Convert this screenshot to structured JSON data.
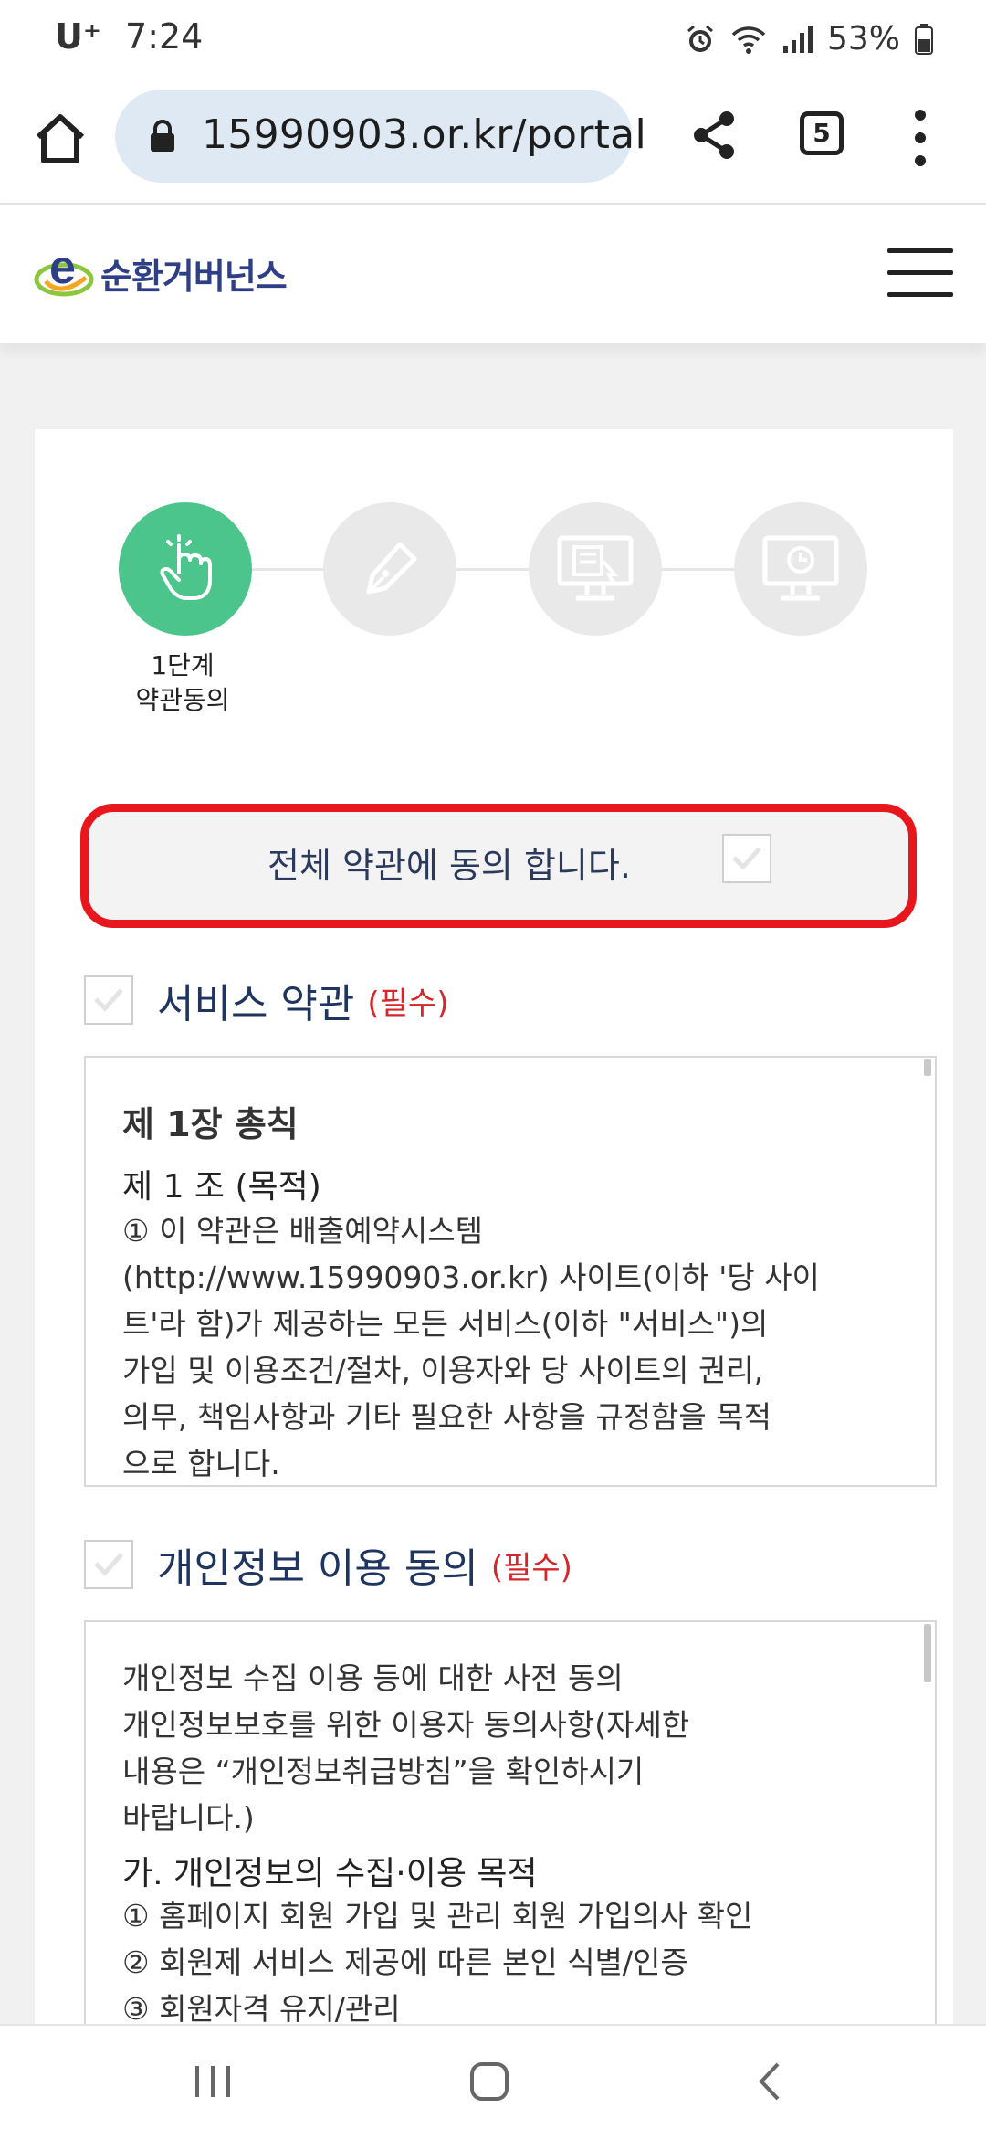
{
  "status_bar": {
    "carrier": "U⁺",
    "time": "7:24",
    "battery": "53%",
    "icons": [
      "alarm-icon",
      "wifi-icon",
      "signal-icon",
      "battery-icon"
    ]
  },
  "browser": {
    "url": "15990903.or.kr/portal",
    "tab_count": "5",
    "icons": [
      "home-icon",
      "lock-icon",
      "share-icon",
      "tabs-icon",
      "more-icon"
    ]
  },
  "header": {
    "logo_text": "순환거버넌스",
    "menu_icon": "hamburger-icon"
  },
  "steps": {
    "active_label_line1": "1단계",
    "active_label_line2": "약관동의",
    "icons": [
      "hand-pointer-icon",
      "pen-icon",
      "monitor-form-icon",
      "monitor-clock-icon"
    ],
    "active_color": "#4cc58d",
    "inactive_color": "#e9e9e9"
  },
  "agree_all": {
    "label": "전체 약관에 동의 합니다.",
    "highlight_color": "#e8171e"
  },
  "service_terms": {
    "title": "서비스 약관",
    "required": "(필수)",
    "chapter": "제 1장 총칙",
    "article": "제 1 조 (목적)",
    "lines": [
      "① 이 약관은 배출예약시스템",
      "(http://www.15990903.or.kr) 사이트(이하 '당 사이",
      "트'라 함)가 제공하는 모든 서비스(이하 \"서비스\")의",
      "가입 및 이용조건/절차, 이용자와 당 사이트의 권리,",
      "의무, 책임사항과 기타 필요한 사항을 규정함을 목적",
      "으로 합니다."
    ]
  },
  "privacy_terms": {
    "title": "개인정보 이용 동의",
    "required": "(필수)",
    "intro_lines": [
      "개인정보 수집 이용 등에 대한 사전 동의",
      "개인정보보호를 위한 이용자 동의사항(자세한",
      "내용은 “개인정보취급방침”을 확인하시기",
      "바랍니다.)"
    ],
    "section": "가. 개인정보의 수집·이용 목적",
    "items": [
      "① 홈페이지 회원 가입 및 관리 회원 가입의사 확인",
      "② 회원제 서비스 제공에 따른 본인 식별/인증",
      "③ 회원자격 유지/관리"
    ]
  },
  "nav_bar": {
    "icons": [
      "recent-apps-icon",
      "home-nav-icon",
      "back-icon"
    ]
  }
}
